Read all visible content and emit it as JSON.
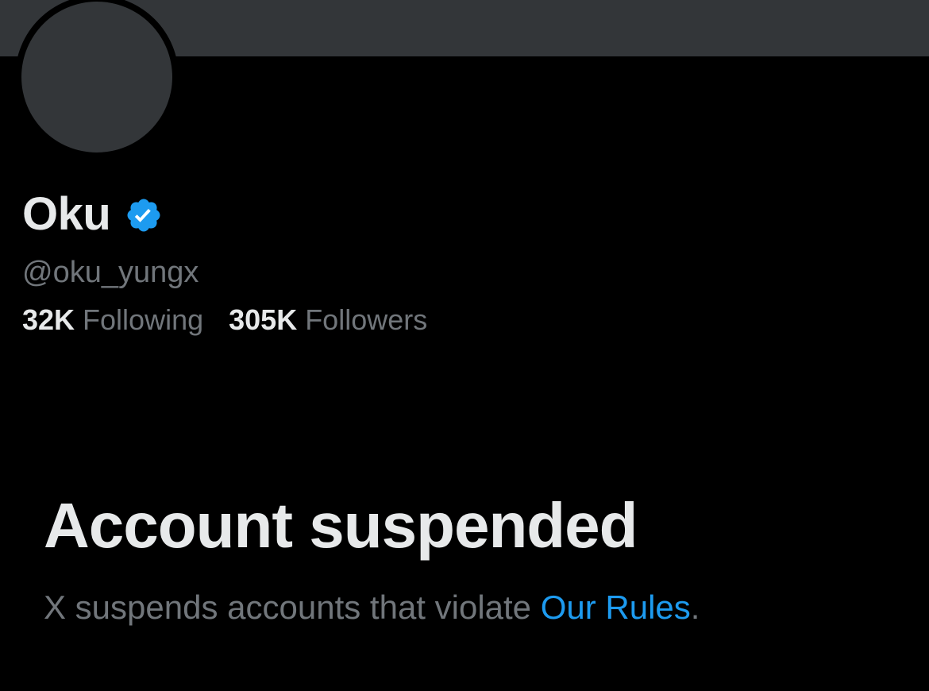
{
  "profile": {
    "display_name": "Oku",
    "handle": "@oku_yungx",
    "verified_icon": "verified-badge-icon",
    "stats": {
      "following_count": "32K",
      "following_label": "Following",
      "followers_count": "305K",
      "followers_label": "Followers"
    }
  },
  "suspension": {
    "title": "Account suspended",
    "message": "X suspends accounts that violate ",
    "link_text": "Our Rules",
    "trailing": "."
  },
  "colors": {
    "background": "#000000",
    "banner": "#333639",
    "primary_text": "#e7e9ea",
    "secondary_text": "#71767b",
    "accent": "#1d9bf0"
  }
}
